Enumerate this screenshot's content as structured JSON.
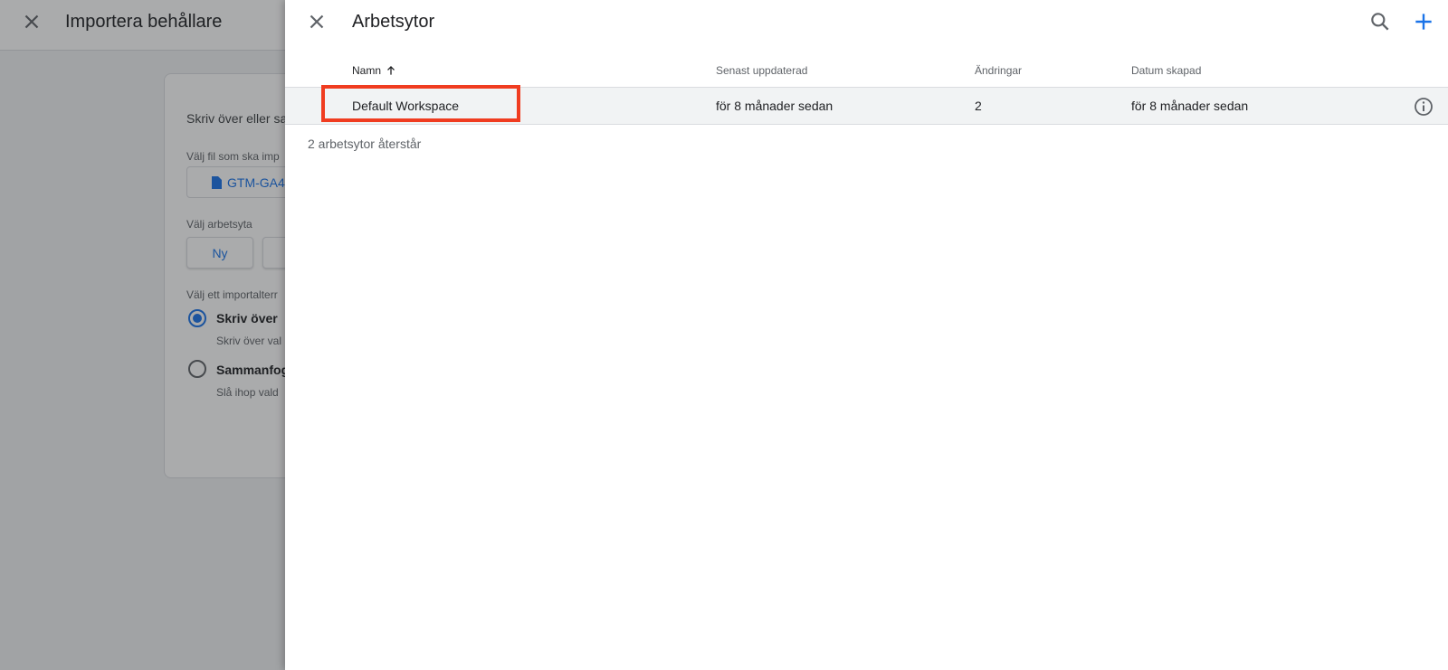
{
  "background_page": {
    "title": "Importera behållare",
    "card": {
      "description": "Skriv över eller sa",
      "file_label": "Välj fil som ska imp",
      "file_button_label": "GTM-GA4",
      "workspace_label": "Välj arbetsyta",
      "new_button_label": "Ny",
      "import_option_label": "Välj ett importalterr",
      "options": [
        {
          "label": "Skriv över",
          "sub": "Skriv över val",
          "checked": true
        },
        {
          "label": "Sammanfog",
          "sub": "Slå ihop vald",
          "checked": false
        }
      ]
    }
  },
  "panel": {
    "title": "Arbetsytor",
    "columns": {
      "name": "Namn",
      "updated": "Senast uppdaterad",
      "changes": "Ändringar",
      "created": "Datum skapad"
    },
    "rows": [
      {
        "name": "Default Workspace",
        "updated": "för 8 månader sedan",
        "changes": "2",
        "created": "för 8 månader sedan"
      }
    ],
    "remaining": "2 arbetsytor återstår"
  },
  "icons": {
    "close": "close-icon",
    "search": "search-icon",
    "add": "add-icon",
    "sort": "arrow-up-icon",
    "info": "info-icon",
    "file": "file-icon"
  },
  "colors": {
    "accent": "#1a73e8",
    "highlight": "#f03c20",
    "row_bg": "#f1f3f4"
  }
}
